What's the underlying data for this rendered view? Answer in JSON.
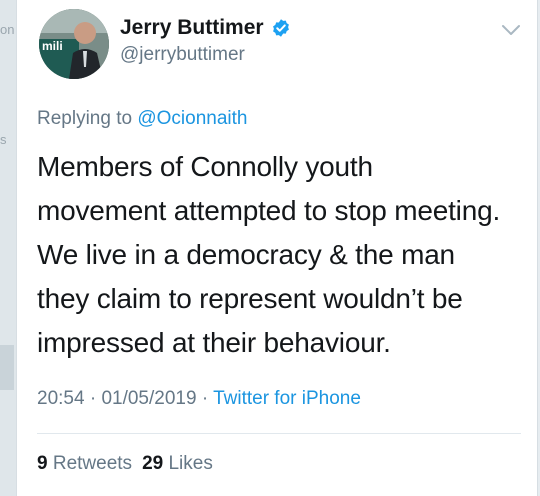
{
  "background_fragments": [
    "on",
    "s"
  ],
  "author": {
    "name": "Jerry Buttimer",
    "handle": "@jerrybuttimer",
    "verified": true,
    "avatar_icon": "profile-photo",
    "avatar_text": "mili"
  },
  "reply": {
    "prefix": "Replying to",
    "mention": "@Ocionnaith"
  },
  "tweet": {
    "lines": [
      "Members of Connolly youth",
      "movement attempted to stop meeting.",
      "We live in a democracy & the man",
      "they claim to represent wouldn’t be",
      "impressed at their behaviour."
    ]
  },
  "meta": {
    "time": "20:54",
    "separator": "·",
    "date": "01/05/2019",
    "source": "Twitter for iPhone"
  },
  "stats": {
    "retweets_count": "9",
    "retweets_label": "Retweets",
    "likes_count": "29",
    "likes_label": "Likes"
  },
  "colors": {
    "link": "#1b95e0",
    "muted": "#657786",
    "text": "#14171a",
    "verified": "#1da1f2"
  }
}
